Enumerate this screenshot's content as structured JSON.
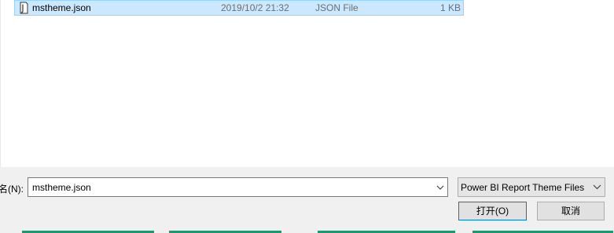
{
  "file_list": {
    "selected_file": {
      "icon": "json-file-icon",
      "name": "mstheme.json",
      "date": "2019/10/2 21:32",
      "type": "JSON File",
      "size": "1 KB"
    }
  },
  "bottom": {
    "filename_label": "名(N):",
    "filename_value": "mstheme.json",
    "filetype_value": "Power BI Report Theme Files",
    "open_label": "打开(O)",
    "cancel_label": "取消"
  },
  "colors": {
    "selection_bg": "#cce8ff",
    "selection_border": "#99d1ff",
    "panel_bg": "#f0f0f0",
    "focus_border": "#0078d7",
    "taskbar_accent": "#1b9a72"
  }
}
